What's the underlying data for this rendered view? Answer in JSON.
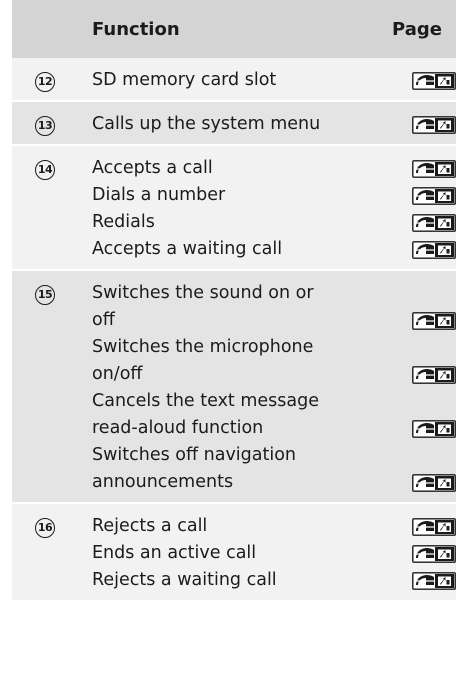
{
  "header": {
    "number": "",
    "function": "Function",
    "page": "Page"
  },
  "rows": [
    {
      "number": "12",
      "functions": [
        {
          "text": [
            "SD memory card slot"
          ]
        }
      ]
    },
    {
      "number": "13",
      "functions": [
        {
          "text": [
            "Calls up the system menu"
          ]
        }
      ]
    },
    {
      "number": "14",
      "functions": [
        {
          "text": [
            "Accepts a call"
          ]
        },
        {
          "text": [
            "Dials a number"
          ]
        },
        {
          "text": [
            "Redials"
          ]
        },
        {
          "text": [
            "Accepts a waiting call"
          ]
        }
      ]
    },
    {
      "number": "15",
      "functions": [
        {
          "text": [
            "Switches the sound on or",
            "off"
          ]
        },
        {
          "text": [
            "Switches the microphone",
            "on/off"
          ]
        },
        {
          "text": [
            "Cancels the text message",
            "read-aloud function"
          ]
        },
        {
          "text": [
            "Switches off navigation",
            "announcements"
          ]
        }
      ]
    },
    {
      "number": "16",
      "functions": [
        {
          "text": [
            "Rejects a call"
          ]
        },
        {
          "text": [
            "Ends an active call"
          ]
        },
        {
          "text": [
            "Rejects a waiting call"
          ]
        }
      ]
    }
  ],
  "icons": {
    "page_reference": "page-reference-icon"
  },
  "colors": {
    "header_bg": "#d4d4d4",
    "row_light": "#f2f2f2",
    "row_dark": "#e4e4e4",
    "text": "#1b1b1b"
  }
}
